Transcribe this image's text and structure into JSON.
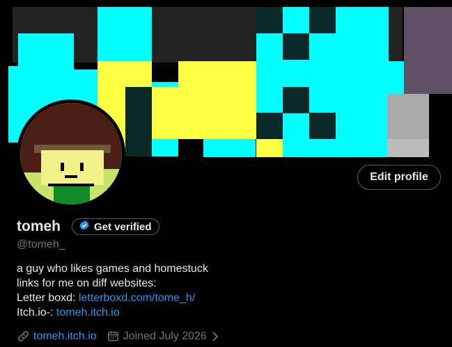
{
  "profile": {
    "name": "tomeh",
    "handle": "@tomeh_",
    "get_verified_label": "Get verified",
    "edit_profile_label": "Edit profile"
  },
  "bio": {
    "line1": "a guy who likes games and homestuck",
    "line2": "links for me on diff websites:",
    "line3_prefix": "Letter boxd: ",
    "line3_link": "letterboxd.com/tome_h/",
    "line4_prefix": "Itch.io-: ",
    "line4_link": "tomeh.itch.io"
  },
  "meta": {
    "website": "tomeh.itch.io",
    "joined": "Joined July 2026"
  },
  "colors": {
    "accent": "#1d9bf0",
    "banner_cyan": "#00ffff",
    "banner_yellow": "#ffff44",
    "banner_dark": "#0a2a2a",
    "banner_purple": "#5f5068",
    "banner_gray": "#aaaaaa"
  },
  "icons": [
    "verified-badge-icon",
    "link-icon",
    "calendar-icon",
    "chevron-right-icon"
  ]
}
